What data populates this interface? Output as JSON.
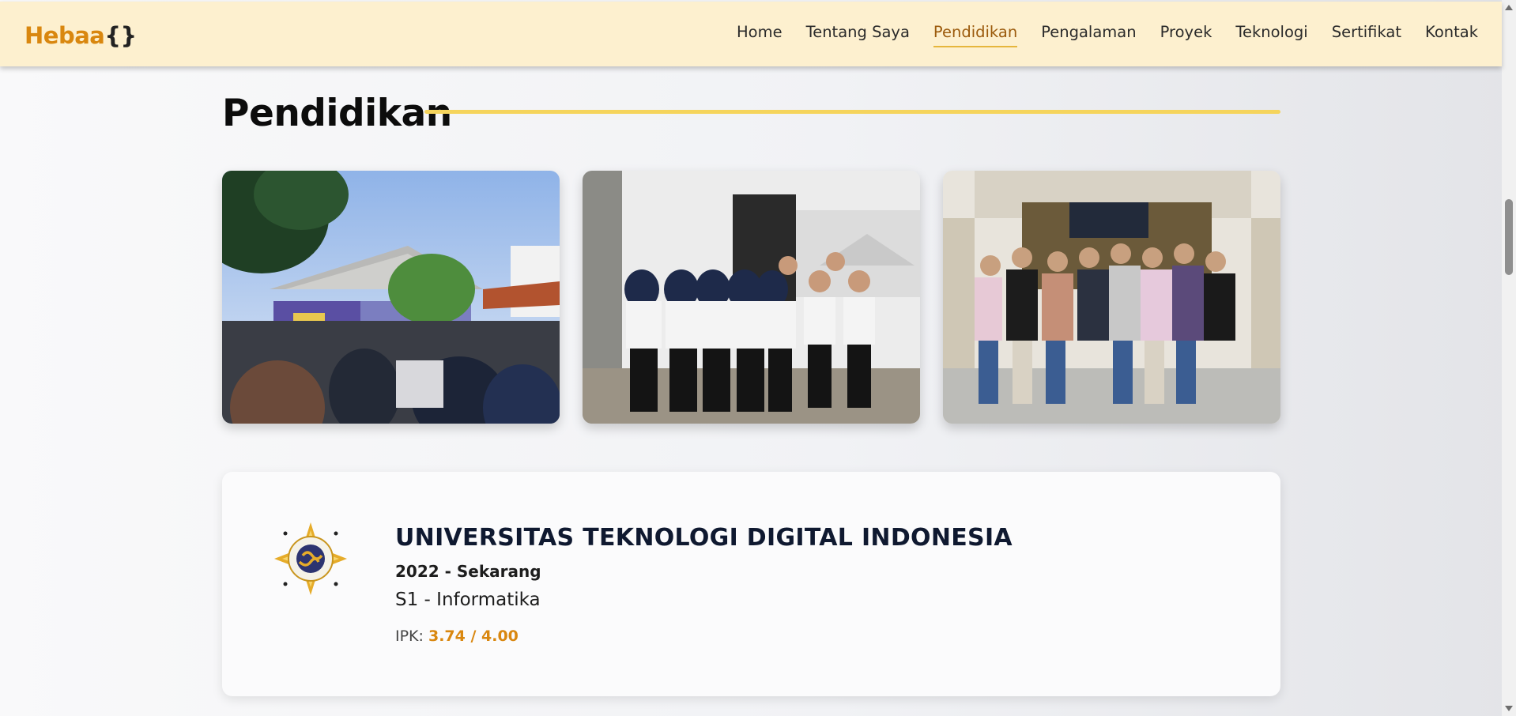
{
  "navbar": {
    "logo_name": "Hebaa",
    "logo_brace": "{}",
    "links": [
      {
        "label": "Home",
        "active": false
      },
      {
        "label": "Tentang Saya",
        "active": false
      },
      {
        "label": "Pendidikan",
        "active": true
      },
      {
        "label": "Pengalaman",
        "active": false
      },
      {
        "label": "Proyek",
        "active": false
      },
      {
        "label": "Teknologi",
        "active": false
      },
      {
        "label": "Sertifikat",
        "active": false
      },
      {
        "label": "Kontak",
        "active": false
      }
    ]
  },
  "section": {
    "title": "Pendidikan",
    "accent_color": "#f5d45c"
  },
  "gallery": [
    {
      "id": "photo-1",
      "description": "campus outdoor stage event"
    },
    {
      "id": "photo-2",
      "description": "student group outdoors"
    },
    {
      "id": "photo-3",
      "description": "student group at building entrance"
    }
  ],
  "education": {
    "institution": "UNIVERSITAS TEKNOLOGI DIGITAL INDONESIA",
    "period": "2022 - Sekarang",
    "degree": "S1 - Informatika",
    "gpa_label": "IPK:",
    "gpa_value": "3.74 / 4.00",
    "logo_icon": "university-emblem-icon"
  },
  "colors": {
    "brand": "#d9870f",
    "nav_bg": "#fdf0cf",
    "active_link": "#9b5a0c"
  }
}
